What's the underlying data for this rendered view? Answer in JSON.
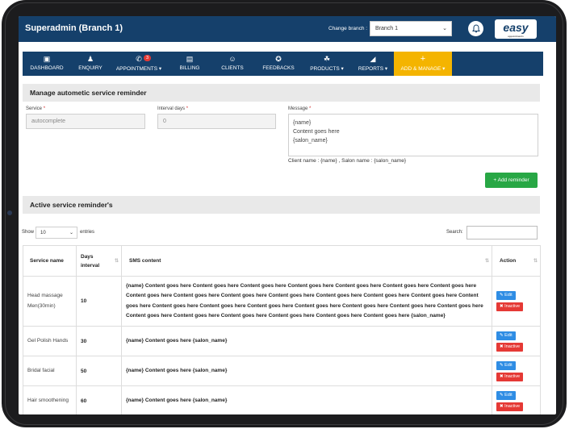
{
  "header": {
    "title": "Superadmin (Branch 1)",
    "change_branch_label": "Change branch :",
    "branch_selected": "Branch 1",
    "logo_text": "easy",
    "logo_subtext": "appointments"
  },
  "nav": {
    "items": [
      {
        "label": "DASHBOARD",
        "icon": "dashboard-icon"
      },
      {
        "label": "ENQUIRY",
        "icon": "user-plus-icon"
      },
      {
        "label": "APPOINTMENTS ▾",
        "icon": "phone-icon",
        "badge": "3"
      },
      {
        "label": "BILLING",
        "icon": "billing-icon"
      },
      {
        "label": "CLIENTS",
        "icon": "clients-icon"
      },
      {
        "label": "FEEDBACKS",
        "icon": "feedback-icon"
      },
      {
        "label": "PRODUCTS ▾",
        "icon": "basket-icon"
      },
      {
        "label": "REPORTS ▾",
        "icon": "chart-icon"
      },
      {
        "label": "ADD & MANAGE ▾",
        "icon": "plus-icon"
      }
    ],
    "active_color": "#f4b400",
    "bg_color": "#15406b"
  },
  "form": {
    "heading": "Manage autometic service reminder",
    "service_label": "Service",
    "service_placeholder": "autocomplete",
    "interval_label": "Interval days",
    "interval_value": "0",
    "message_label": "Message",
    "message_lines": [
      "{name}",
      "Content goes here",
      "{salon_name}"
    ],
    "hint": "Client name : {name} , Salon name : {salon_name}",
    "add_button": "+ Add reminder"
  },
  "list": {
    "heading": "Active service reminder's",
    "show_label": "Show",
    "entries_value": "10",
    "entries_label": "entries",
    "search_label": "Search:",
    "columns": {
      "service_name": "Service name",
      "days_line1": "Days",
      "days_line2": "interval",
      "sms": "SMS content",
      "action": "Action"
    },
    "edit_label": "Edit",
    "inactive_label": "Inactive",
    "rows": [
      {
        "service": "Head massage Men(30min)",
        "days": "10",
        "sms": "{name} Content goes here Content goes here Content goes here Content goes here Content goes here Content goes here Content goes here Content goes here Content goes here Content goes here Content goes here Content goes here Content goes here Content goes here Content goes here Content goes here Content goes here Content goes here Content goes here Content goes here Content goes here Content goes here Content goes here Content goes here Content goes here Content goes here Content goes here Content goes here {salon_name}"
      },
      {
        "service": "Gel Polish Hands",
        "days": "30",
        "sms": "{name} Content goes here {salon_name}"
      },
      {
        "service": "Bridal facial",
        "days": "50",
        "sms": "{name} Content goes here {salon_name}"
      },
      {
        "service": "Hair smoothening",
        "days": "60",
        "sms": "{name} Content goes here {salon_name}"
      }
    ]
  }
}
